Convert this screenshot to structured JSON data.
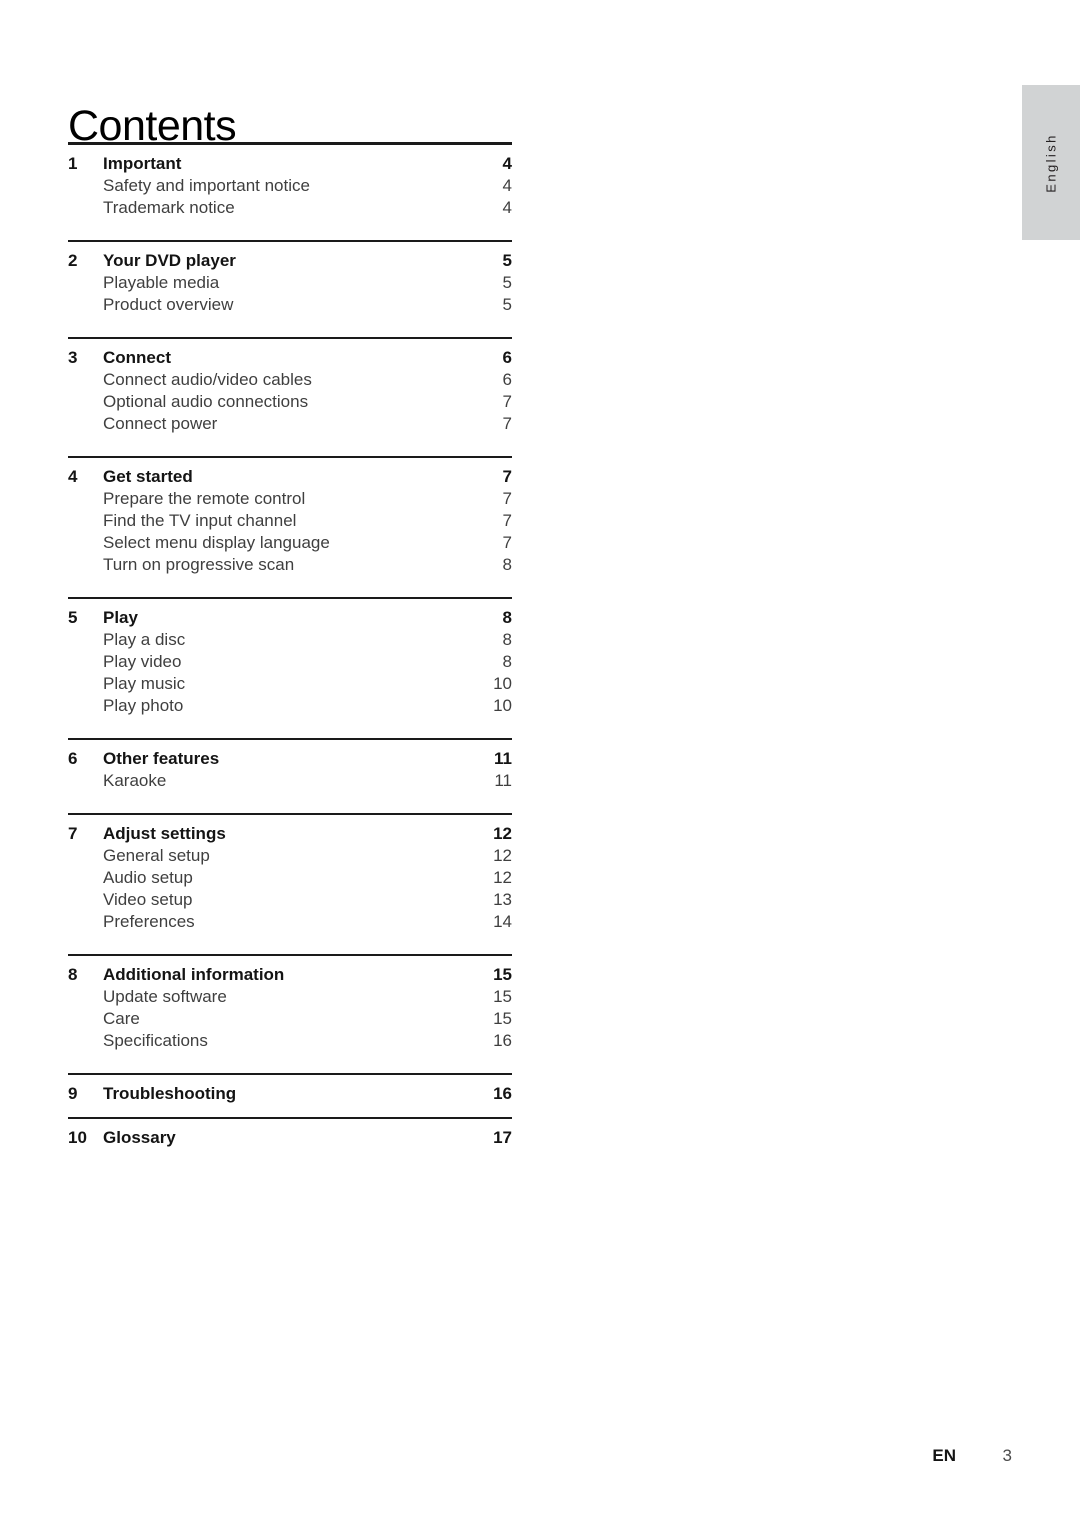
{
  "page": {
    "title": "Contents",
    "language_tab": "English",
    "footer": {
      "locale": "EN",
      "page_number": "3"
    }
  },
  "toc": {
    "sections": [
      {
        "number": "1",
        "title": "Important",
        "page": "4",
        "items": [
          {
            "label": "Safety and important notice",
            "page": "4"
          },
          {
            "label": "Trademark notice",
            "page": "4"
          }
        ]
      },
      {
        "number": "2",
        "title": "Your DVD player",
        "page": "5",
        "items": [
          {
            "label": "Playable media",
            "page": "5"
          },
          {
            "label": "Product overview",
            "page": "5"
          }
        ]
      },
      {
        "number": "3",
        "title": "Connect",
        "page": "6",
        "items": [
          {
            "label": "Connect audio/video cables",
            "page": "6"
          },
          {
            "label": "Optional audio connections",
            "page": "7"
          },
          {
            "label": "Connect power",
            "page": "7"
          }
        ]
      },
      {
        "number": "4",
        "title": "Get started",
        "page": "7",
        "items": [
          {
            "label": "Prepare the remote control",
            "page": "7"
          },
          {
            "label": "Find the TV input channel",
            "page": "7"
          },
          {
            "label": "Select menu display language",
            "page": "7"
          },
          {
            "label": "Turn on progressive scan",
            "page": "8"
          }
        ]
      },
      {
        "number": "5",
        "title": "Play",
        "page": "8",
        "items": [
          {
            "label": "Play a disc",
            "page": "8"
          },
          {
            "label": "Play video",
            "page": "8"
          },
          {
            "label": "Play music",
            "page": "10"
          },
          {
            "label": "Play photo",
            "page": "10"
          }
        ]
      },
      {
        "number": "6",
        "title": "Other features",
        "page": "11",
        "items": [
          {
            "label": "Karaoke",
            "page": "11"
          }
        ]
      },
      {
        "number": "7",
        "title": "Adjust settings",
        "page": "12",
        "items": [
          {
            "label": "General setup",
            "page": "12"
          },
          {
            "label": "Audio setup",
            "page": "12"
          },
          {
            "label": "Video setup",
            "page": "13"
          },
          {
            "label": "Preferences",
            "page": "14"
          }
        ]
      },
      {
        "number": "8",
        "title": "Additional information",
        "page": "15",
        "items": [
          {
            "label": "Update software",
            "page": "15"
          },
          {
            "label": "Care",
            "page": "15"
          },
          {
            "label": "Specifications",
            "page": "16"
          }
        ]
      },
      {
        "number": "9",
        "title": "Troubleshooting",
        "page": "16",
        "items": []
      },
      {
        "number": "10",
        "title": "Glossary",
        "page": "17",
        "items": []
      }
    ]
  },
  "colors": {
    "tab_background": "#d1d3d4",
    "rule": "#1a1a1a",
    "heading_text": "#141414",
    "sub_text": "#3f3f3f"
  }
}
